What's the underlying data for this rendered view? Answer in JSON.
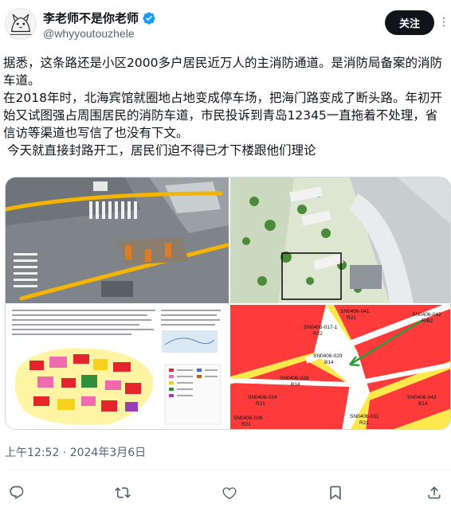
{
  "header": {
    "display_name": "李老师不是你老师",
    "handle": "@whyyoutouzhele",
    "follow_label": "关注",
    "more_label": "⋮",
    "verified_color": "#1d9bf0"
  },
  "tweet": {
    "paragraphs": [
      "据悉，这条路还是小区2000多户居民近万人的主消防通道。是消防局备案的消防车道。",
      "在2018年时，北海宾馆就圈地占地变成停车场，把海门路变成了断头路。年初开始又试图强占周围居民的消防车道，市民投诉到青岛12345一直拖着不处理，省信访等渠道也写信了也没有下文。",
      " 今天就直接封路开工，居民们迫不得已才下楼跟他们理论"
    ]
  },
  "media": {
    "images": [
      {
        "icon": "street-construction-photo"
      },
      {
        "icon": "aerial-site-plan"
      },
      {
        "icon": "zoning-document"
      },
      {
        "icon": "zoning-map"
      }
    ],
    "map_labels": [
      "SN0406-041",
      "R21",
      "SN0406-042",
      "R/B2",
      "SN0406-017-1",
      "R22",
      "SN0406-029",
      "B14",
      "SN0406-028",
      "B14",
      "SN0406-024",
      "R21",
      "SN0406-043",
      "B14",
      "SN0406-026",
      "R21",
      "SN0406-031",
      "R21"
    ]
  },
  "timestamp": "上午12:52 · 2024年3月6日",
  "actions": {
    "reply_icon": "reply-icon",
    "retweet_icon": "retweet-icon",
    "like_icon": "heart-icon",
    "bookmark_icon": "bookmark-icon",
    "share_icon": "share-icon"
  }
}
